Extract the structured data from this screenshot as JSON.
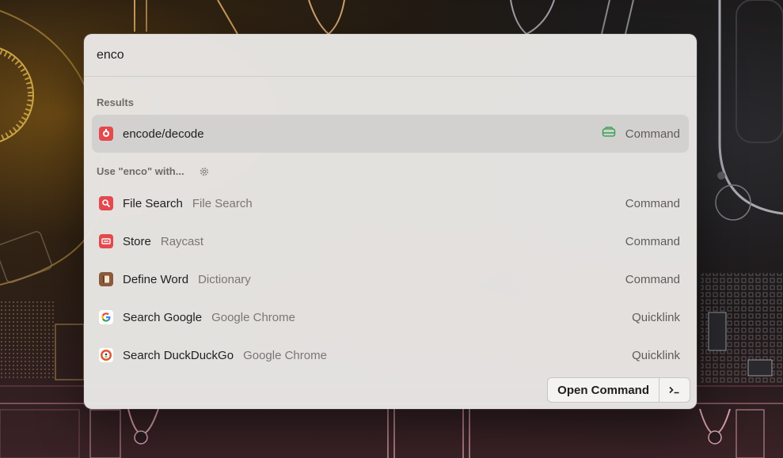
{
  "search": {
    "value": "enco"
  },
  "results": {
    "section_title": "Results",
    "items": [
      {
        "title": "encode/decode",
        "accessory": "Command",
        "icon": "encode-decode-icon",
        "accessory_icon": "extension-tray-icon"
      }
    ]
  },
  "fallback": {
    "section_title": "Use \"enco\" with...",
    "items": [
      {
        "title": "File Search",
        "subtitle": "File Search",
        "accessory": "Command",
        "icon": "file-search-icon"
      },
      {
        "title": "Store",
        "subtitle": "Raycast",
        "accessory": "Command",
        "icon": "store-icon"
      },
      {
        "title": "Define Word",
        "subtitle": "Dictionary",
        "accessory": "Command",
        "icon": "dictionary-icon"
      },
      {
        "title": "Search Google",
        "subtitle": "Google Chrome",
        "accessory": "Quicklink",
        "icon": "google-icon"
      },
      {
        "title": "Search DuckDuckGo",
        "subtitle": "Google Chrome",
        "accessory": "Quicklink",
        "icon": "duckduckgo-icon"
      }
    ]
  },
  "footer": {
    "primary_action": "Open Command",
    "shortcut": "›_"
  },
  "colors": {
    "selected_row": "#d3d1cf",
    "accent_red": "#e5484d",
    "accent_green": "#3fa45b"
  }
}
